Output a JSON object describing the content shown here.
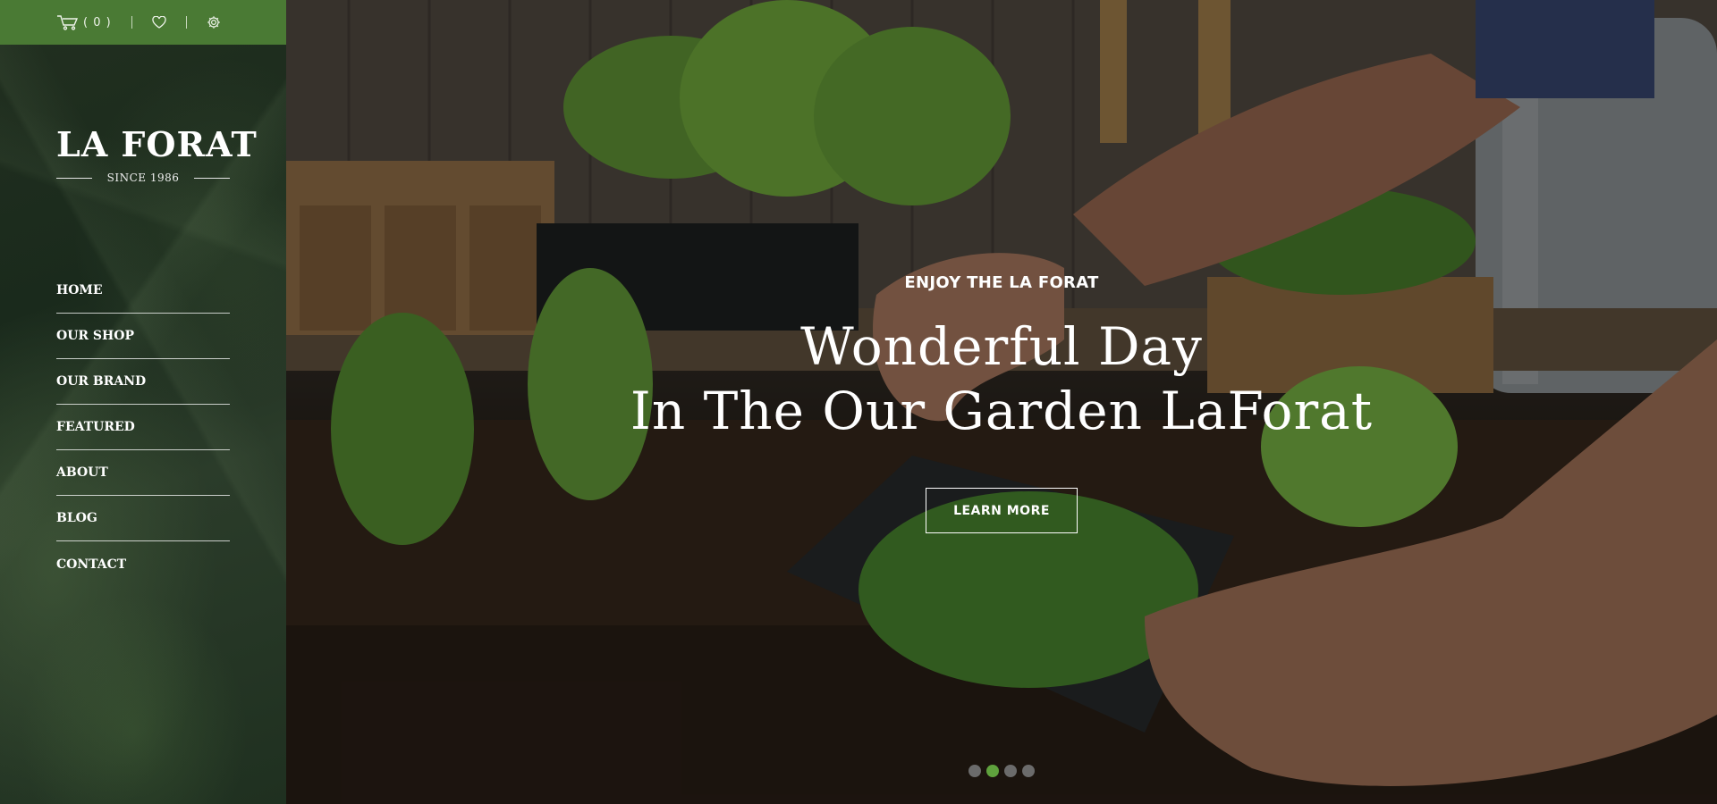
{
  "topbar": {
    "cart_count": "( 0 )",
    "cart_icon": "cart-icon",
    "wishlist_icon": "heart-icon",
    "settings_icon": "gear-icon",
    "bg_color": "#4a7a34"
  },
  "brand": {
    "name": "LA FORAT",
    "since": "SINCE 1986"
  },
  "nav": {
    "items": [
      {
        "label": "HOME"
      },
      {
        "label": "OUR SHOP"
      },
      {
        "label": "OUR BRAND"
      },
      {
        "label": "FEATURED"
      },
      {
        "label": "ABOUT"
      },
      {
        "label": "BLOG"
      },
      {
        "label": "CONTACT"
      }
    ]
  },
  "hero": {
    "eyebrow": "ENJOY THE LA FORAT",
    "headline_line1": "Wonderful Day",
    "headline_line2": "In The Our Garden LaForat",
    "button_label": "LEARN MORE",
    "slides": 4,
    "active_slide": 2,
    "accent_color": "#5fa23d"
  }
}
